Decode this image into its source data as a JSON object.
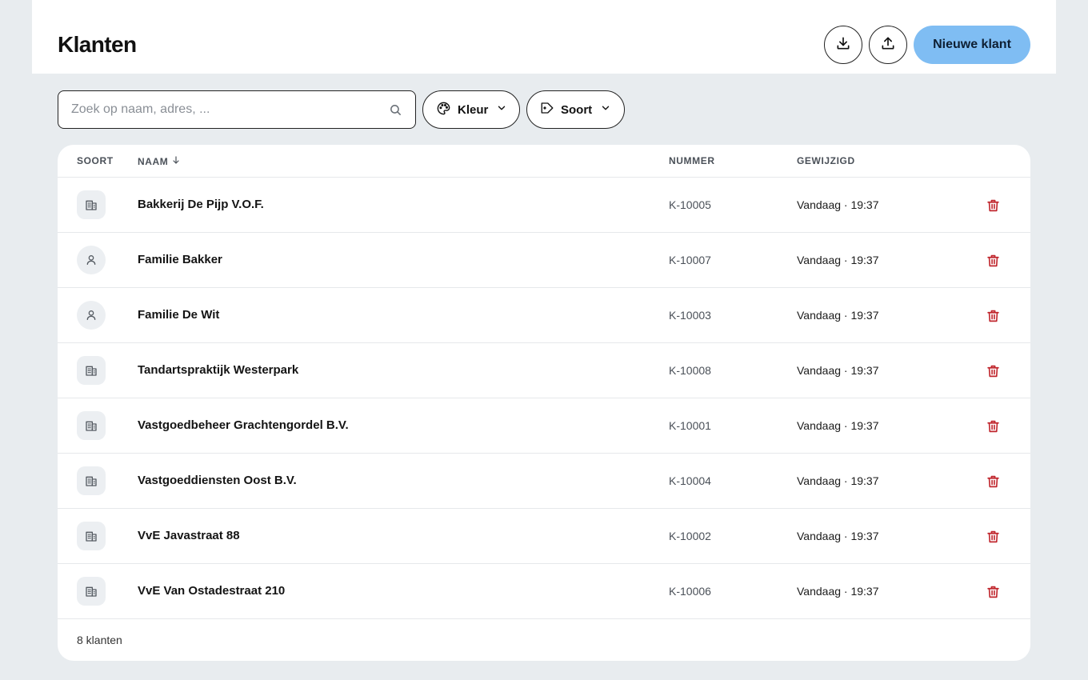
{
  "header": {
    "title": "Klanten",
    "download_icon": "download-icon",
    "upload_icon": "upload-icon",
    "new_label": "Nieuwe klant",
    "accent_color": "#7fbdf3"
  },
  "toolbar": {
    "search_placeholder": "Zoek op naam, adres, ...",
    "search_value": "",
    "filter_color_label": "Kleur",
    "filter_type_label": "Soort"
  },
  "table": {
    "columns": {
      "soort": "SOORT",
      "naam": "NAAM",
      "nummer": "NUMMER",
      "gewijzigd": "GEWIJZIGD"
    },
    "sort": {
      "column": "naam",
      "direction": "desc-arrow"
    },
    "rows": [
      {
        "type": "building",
        "name": "Bakkerij De Pijp V.O.F.",
        "number": "K-10005",
        "modified": "Vandaag · 19:37"
      },
      {
        "type": "person",
        "name": "Familie Bakker",
        "number": "K-10007",
        "modified": "Vandaag · 19:37"
      },
      {
        "type": "person",
        "name": "Familie De Wit",
        "number": "K-10003",
        "modified": "Vandaag · 19:37"
      },
      {
        "type": "building",
        "name": "Tandartspraktijk Westerpark",
        "number": "K-10008",
        "modified": "Vandaag · 19:37"
      },
      {
        "type": "building",
        "name": "Vastgoedbeheer Grachtengordel B.V.",
        "number": "K-10001",
        "modified": "Vandaag · 19:37"
      },
      {
        "type": "building",
        "name": "Vastgoeddiensten Oost B.V.",
        "number": "K-10004",
        "modified": "Vandaag · 19:37"
      },
      {
        "type": "building",
        "name": "VvE Javastraat 88",
        "number": "K-10002",
        "modified": "Vandaag · 19:37"
      },
      {
        "type": "building",
        "name": "VvE Van Ostadestraat 210",
        "number": "K-10006",
        "modified": "Vandaag · 19:37"
      }
    ],
    "delete_color": "#c0262d",
    "footer_count": "8 klanten"
  }
}
